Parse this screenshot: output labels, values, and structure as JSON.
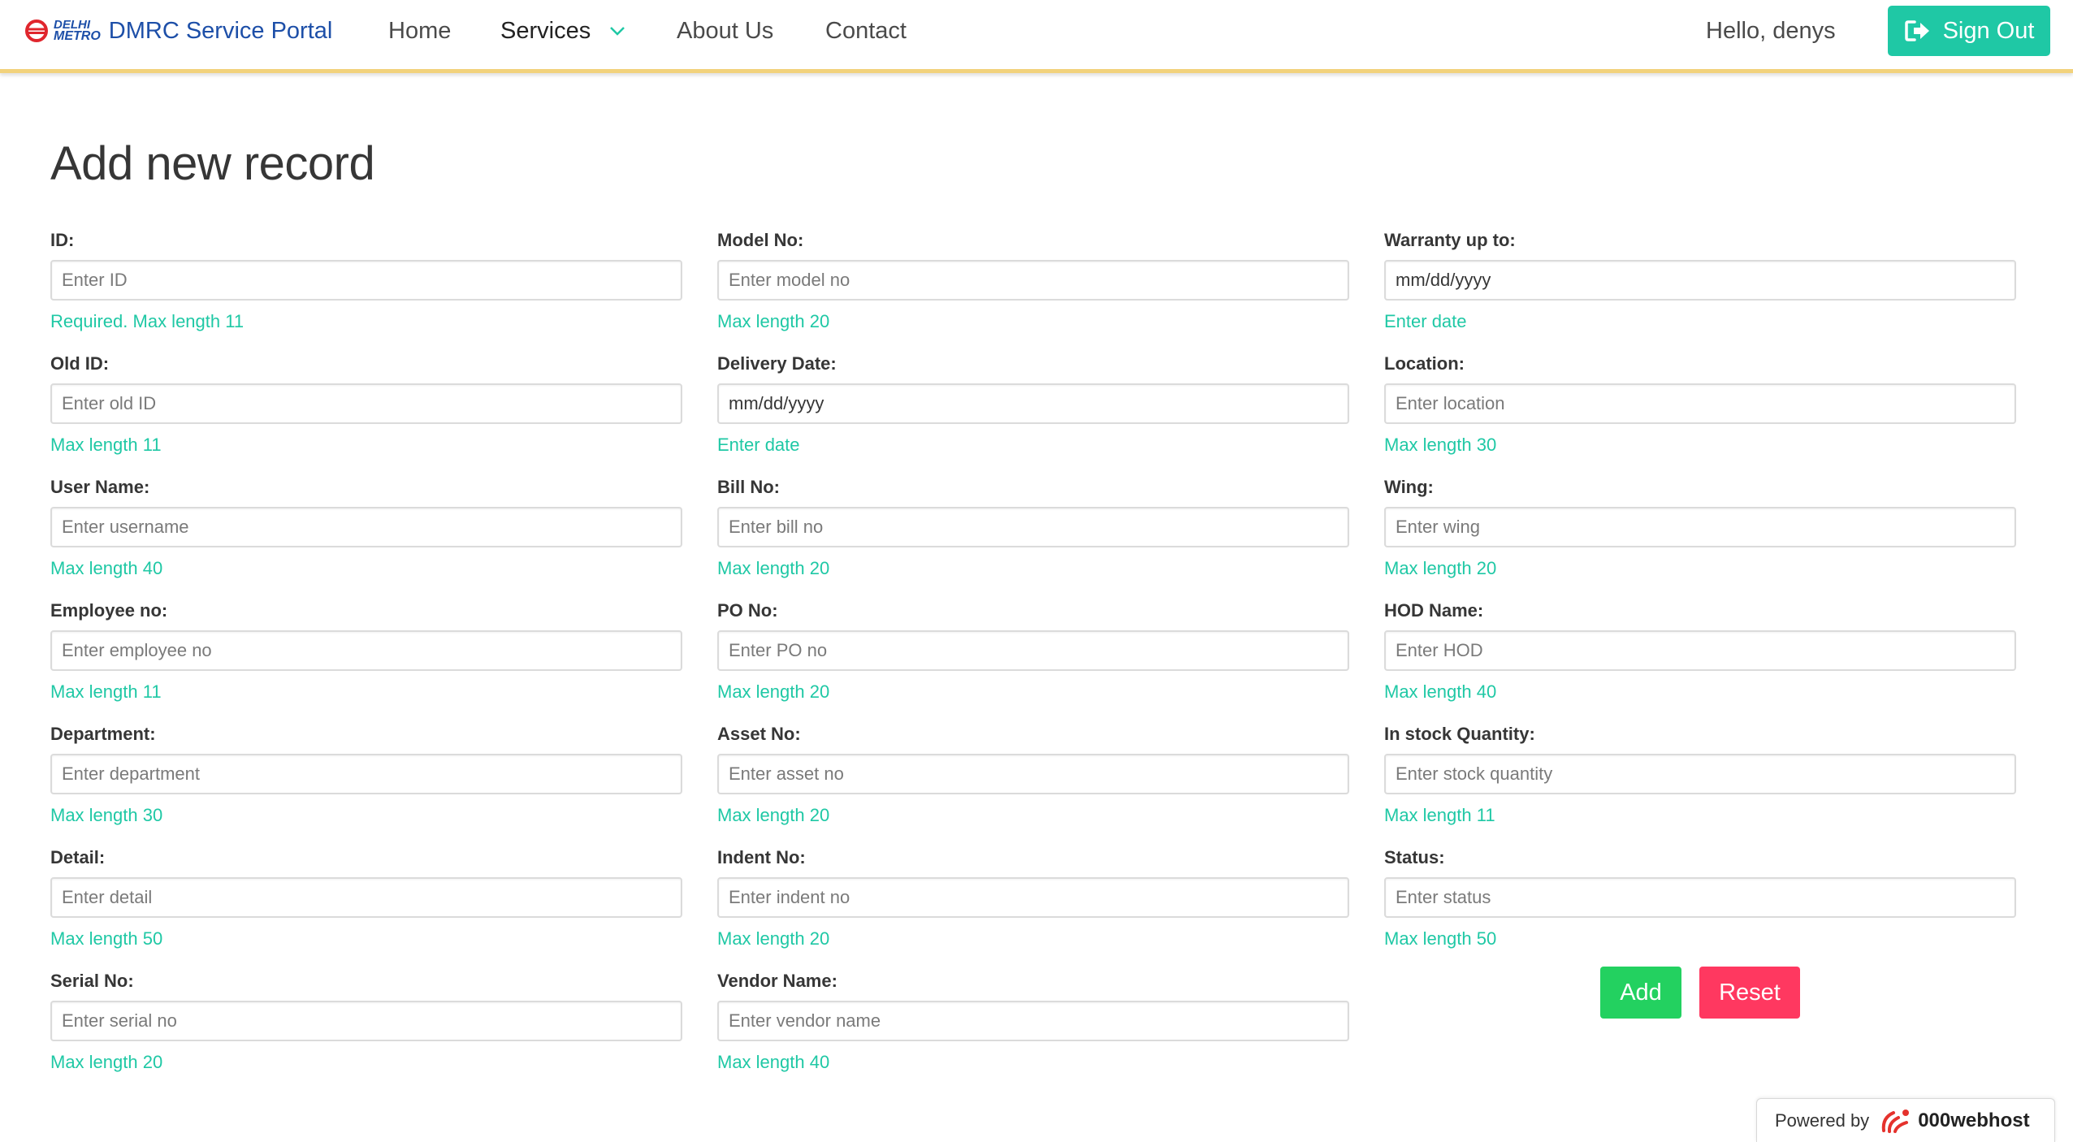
{
  "nav": {
    "logo_line1": "DELHI",
    "logo_line2": "METRO",
    "brand_title": "DMRC Service Portal",
    "home": "Home",
    "services": "Services",
    "about": "About Us",
    "contact": "Contact",
    "greeting": "Hello, denys",
    "signout": "Sign Out"
  },
  "page": {
    "title": "Add new record"
  },
  "form": {
    "id": {
      "label": "ID:",
      "placeholder": "Enter ID",
      "help": "Required. Max length 11"
    },
    "old_id": {
      "label": "Old ID:",
      "placeholder": "Enter old ID",
      "help": "Max length 11"
    },
    "user_name": {
      "label": "User Name:",
      "placeholder": "Enter username",
      "help": "Max length 40"
    },
    "employee_no": {
      "label": "Employee no:",
      "placeholder": "Enter employee no",
      "help": "Max length 11"
    },
    "department": {
      "label": "Department:",
      "placeholder": "Enter department",
      "help": "Max length 30"
    },
    "detail": {
      "label": "Detail:",
      "placeholder": "Enter detail",
      "help": "Max length 50"
    },
    "serial_no": {
      "label": "Serial No:",
      "placeholder": "Enter serial no",
      "help": "Max length 20"
    },
    "model_no": {
      "label": "Model No:",
      "placeholder": "Enter model no",
      "help": "Max length 20"
    },
    "delivery_date": {
      "label": "Delivery Date:",
      "value": "mm/dd/yyyy",
      "help": "Enter date"
    },
    "bill_no": {
      "label": "Bill No:",
      "placeholder": "Enter bill no",
      "help": "Max length 20"
    },
    "po_no": {
      "label": "PO No:",
      "placeholder": "Enter PO no",
      "help": "Max length 20"
    },
    "asset_no": {
      "label": "Asset No:",
      "placeholder": "Enter asset no",
      "help": "Max length 20"
    },
    "indent_no": {
      "label": "Indent No:",
      "placeholder": "Enter indent no",
      "help": "Max length 20"
    },
    "vendor_name": {
      "label": "Vendor Name:",
      "placeholder": "Enter vendor name",
      "help": "Max length 40"
    },
    "warranty": {
      "label": "Warranty up to:",
      "value": "mm/dd/yyyy",
      "help": "Enter date"
    },
    "location": {
      "label": "Location:",
      "placeholder": "Enter location",
      "help": "Max length 30"
    },
    "wing": {
      "label": "Wing:",
      "placeholder": "Enter wing",
      "help": "Max length 20"
    },
    "hod_name": {
      "label": "HOD Name:",
      "placeholder": "Enter HOD",
      "help": "Max length 40"
    },
    "stock_qty": {
      "label": "In stock Quantity:",
      "placeholder": "Enter stock quantity",
      "help": "Max length 11"
    },
    "status": {
      "label": "Status:",
      "placeholder": "Enter status",
      "help": "Max length 50"
    },
    "add_label": "Add",
    "reset_label": "Reset"
  },
  "footer": {
    "powered_by": "Powered by",
    "host": "000webhost"
  },
  "colors": {
    "brand_blue": "#1d4fa8",
    "accent_teal": "#1fc8a5",
    "add_green": "#23d160",
    "reset_red": "#ff3860",
    "nav_underline": "#f2d27c"
  },
  "icons": {
    "logo": "dmrc-logo-icon",
    "services_chevron": "chevron-down-icon",
    "signout": "sign-out-icon",
    "webhost": "000webhost-logo-icon"
  }
}
